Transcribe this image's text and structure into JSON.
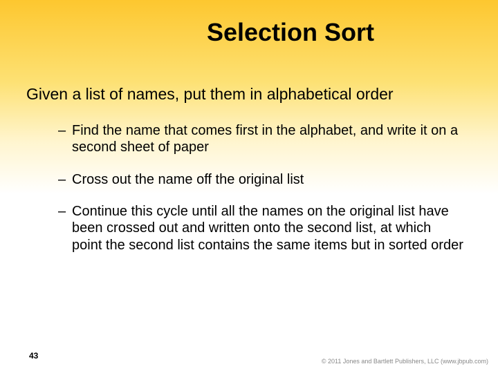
{
  "title": "Selection Sort",
  "intro": "Given a list of names, put them in alphabetical order",
  "bullets": [
    "Find the name that comes first in the alphabet, and write it on a second sheet of paper",
    "Cross out the name off the original list",
    "Continue this cycle until all the names on the original list have been crossed out and written onto the second list, at which point the second list contains the same items but in sorted order"
  ],
  "pageNumber": "43",
  "copyright": "© 2011 Jones and Bartlett Publishers, LLC (www.jbpub.com)"
}
